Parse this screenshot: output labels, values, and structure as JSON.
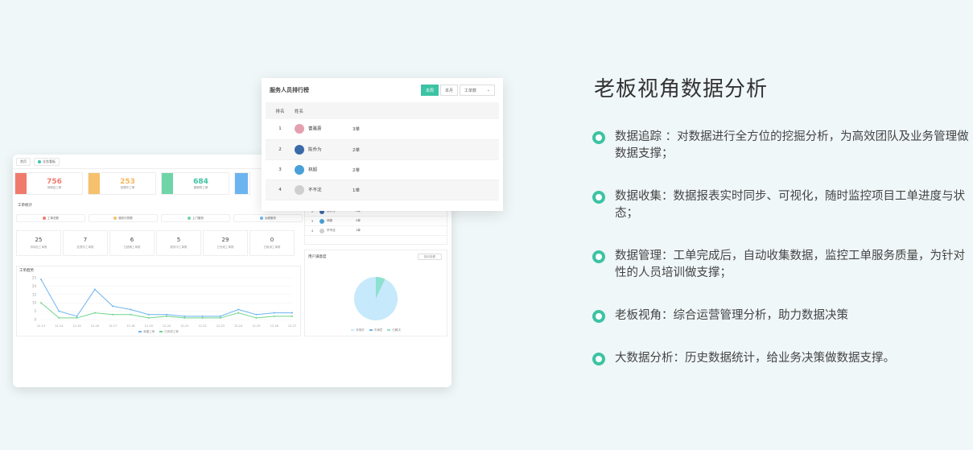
{
  "colors": {
    "accent": "#3cc3a3",
    "background": "#f0f7f8"
  },
  "dashboard": {
    "tabs": [
      "首页",
      "业务看板"
    ],
    "kpis": [
      {
        "value": "756",
        "label": "待响应工单",
        "color": "#f07b6d",
        "text_color": "#f07b6d"
      },
      {
        "value": "253",
        "label": "处理中工单",
        "color": "#f5c16c",
        "text_color": "#f5b85c"
      },
      {
        "value": "684",
        "label": "超期的工单",
        "color": "#6fd4a8",
        "text_color": "#3cc3a3"
      },
      {
        "value": "",
        "label": "",
        "color": "#6cb4f0",
        "text_color": "#6cb4f0"
      }
    ],
    "section_title": "工单统计",
    "chips": [
      {
        "label": "工单总数",
        "dot": "#f07b6d"
      },
      {
        "label": "服务中的数",
        "dot": "#f5c16c"
      },
      {
        "label": "上门服务",
        "dot": "#6fd4a8"
      },
      {
        "label": "远程服务",
        "dot": "#6cb4f0"
      }
    ],
    "stats": [
      {
        "value": "25",
        "label": "待响应工单数"
      },
      {
        "value": "7",
        "label": "处理中工单数"
      },
      {
        "value": "6",
        "label": "已超期工单数"
      },
      {
        "value": "5",
        "label": "服务中工单数"
      },
      {
        "value": "29",
        "label": "已完成工单数"
      },
      {
        "value": "0",
        "label": "已取消工单数"
      }
    ],
    "line_title": "工单趋势",
    "pie_title": "用户满意度",
    "pie_select": "按月查看",
    "mini_rows": [
      {
        "rank": "2",
        "name": "陈乔为",
        "count": "2单"
      },
      {
        "rank": "3",
        "name": "林超",
        "count": "2单"
      },
      {
        "rank": "4",
        "name": "不不沈",
        "count": "1单"
      }
    ],
    "pie_legend": [
      "非常好",
      "不满意",
      "已解决"
    ],
    "line_legend": [
      "新建工单",
      "已完成工单"
    ]
  },
  "chart_data": [
    {
      "type": "line",
      "x": [
        "12-13",
        "12-14",
        "12-15",
        "12-16",
        "12-17",
        "12-18",
        "12-19",
        "12-20",
        "12-21",
        "12-22",
        "12-23",
        "12-24",
        "12-25",
        "12-26",
        "12-27"
      ],
      "series": [
        {
          "name": "新建工单",
          "values": [
            24,
            5,
            2,
            18,
            8,
            6,
            3,
            3,
            2,
            2,
            2,
            6,
            3,
            4,
            4
          ]
        },
        {
          "name": "已完成工单",
          "values": [
            10,
            1,
            1,
            4,
            3,
            3,
            1,
            2,
            1,
            1,
            1,
            4,
            1,
            2,
            2
          ]
        }
      ],
      "ylim": [
        0,
        25
      ],
      "yticks": [
        0,
        5,
        10,
        15,
        20,
        25
      ]
    },
    {
      "type": "pie",
      "slices": [
        {
          "label": "非常好",
          "value": 93,
          "color": "#c6e9fb"
        },
        {
          "label": "已解决",
          "value": 7,
          "color": "#8ee0d0"
        }
      ]
    }
  ],
  "ranking": {
    "title": "服务人员排行榜",
    "buttons": {
      "week": "本周",
      "month": "本月"
    },
    "select": "工单数",
    "columns": {
      "rank": "排名",
      "name": "姓名"
    },
    "rows": [
      {
        "rank": "1",
        "name": "曹雅惠",
        "count": "3单",
        "avatar_color": "#e5a0b0"
      },
      {
        "rank": "2",
        "name": "陈乔为",
        "count": "2单",
        "avatar_color": "#3a6aa8"
      },
      {
        "rank": "3",
        "name": "林超",
        "count": "2单",
        "avatar_color": "#4aa0d8"
      },
      {
        "rank": "4",
        "name": "不不沈",
        "count": "1单",
        "avatar_color": "#cfcfcf"
      }
    ]
  },
  "heading": "老板视角数据分析",
  "features": [
    "数据追踪 ：对数据进行全方位的挖掘分析，为高效团队及业务管理做数据支撑；",
    "数据收集：数据报表实时同步、可视化，随时监控项目工单进度与状态；",
    "数据管理：工单完成后，自动收集数据，监控工单服务质量，为针对性的人员培训做支撑；",
    "老板视角：综合运营管理分析，助力数据决策",
    "大数据分析：历史数据统计，给业务决策做数据支撑。"
  ]
}
